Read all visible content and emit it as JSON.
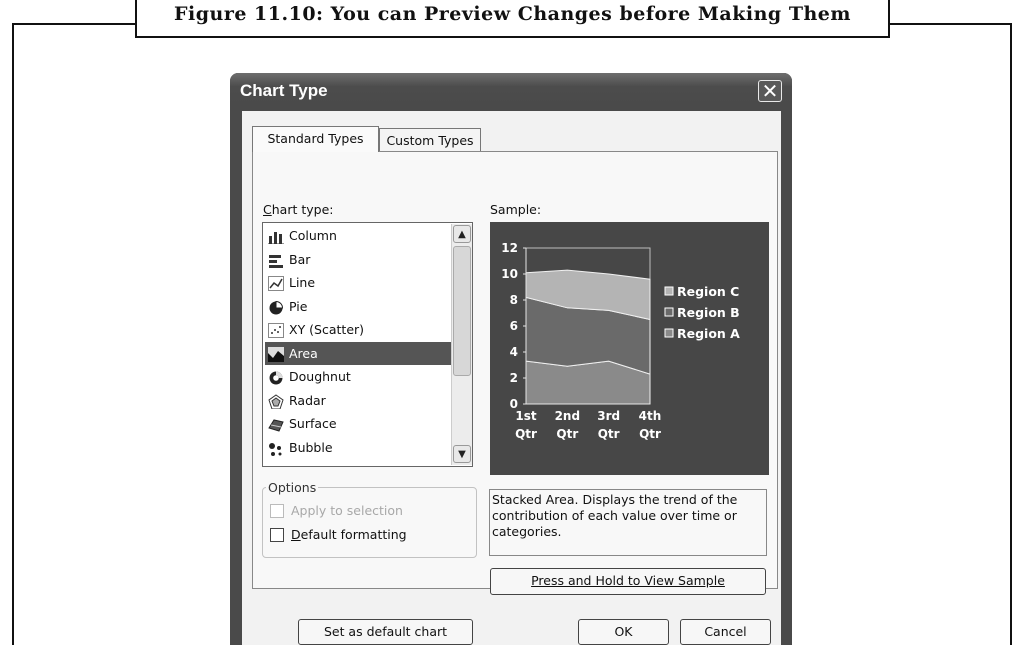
{
  "figure_caption": "Figure 11.10: You can Preview Changes before Making Them",
  "dialog": {
    "title": "Chart Type",
    "close_glyph": "✕",
    "tabs": [
      {
        "label": "Standard Types",
        "active": true
      },
      {
        "label": "Custom Types",
        "active": false
      }
    ],
    "chart_type_label": "Chart type:",
    "chart_type_label_mnemonic": "C",
    "chart_types": [
      {
        "label": "Column",
        "icon": "column-chart-icon"
      },
      {
        "label": "Bar",
        "icon": "bar-chart-icon"
      },
      {
        "label": "Line",
        "icon": "line-chart-icon"
      },
      {
        "label": "Pie",
        "icon": "pie-chart-icon"
      },
      {
        "label": "XY (Scatter)",
        "icon": "scatter-chart-icon"
      },
      {
        "label": "Area",
        "icon": "area-chart-icon",
        "selected": true
      },
      {
        "label": "Doughnut",
        "icon": "doughnut-chart-icon"
      },
      {
        "label": "Radar",
        "icon": "radar-chart-icon"
      },
      {
        "label": "Surface",
        "icon": "surface-chart-icon"
      },
      {
        "label": "Bubble",
        "icon": "bubble-chart-icon"
      }
    ],
    "sample_label": "Sample:",
    "options_label": "Options",
    "apply_to_selection_label": "Apply to selection",
    "apply_to_selection_enabled": false,
    "default_formatting_label": "Default formatting",
    "default_formatting_mnemonic": "D",
    "default_formatting_checked": false,
    "description": "Stacked Area. Displays the trend of the contribution of each value over time or categories.",
    "press_hold_label": "Press and Hold to View Sample",
    "set_default_label": "Set as default chart",
    "ok_label": "OK",
    "cancel_label": "Cancel",
    "colors": {
      "title_bar": "#4a4a4a",
      "selection": "#555555",
      "sample_background": "#474747",
      "region_a": "#8a8a8a",
      "region_b": "#6a6a6a",
      "region_c": "#b4b4b4"
    }
  },
  "chart_data": {
    "type": "area",
    "stacked": true,
    "categories": [
      "1st Qtr",
      "2nd Qtr",
      "3rd Qtr",
      "4th Qtr"
    ],
    "series": [
      {
        "name": "Region A",
        "values": [
          3.3,
          2.9,
          3.3,
          2.3
        ]
      },
      {
        "name": "Region B",
        "values": [
          4.9,
          4.5,
          3.9,
          4.2
        ]
      },
      {
        "name": "Region C",
        "values": [
          1.9,
          2.9,
          2.8,
          3.1
        ]
      }
    ],
    "legend_order": [
      "Region C",
      "Region B",
      "Region A"
    ],
    "legend_position": "right",
    "yticks": [
      "0",
      "2",
      "4",
      "6",
      "8",
      "10",
      "12"
    ],
    "ylim": [
      0,
      12
    ]
  }
}
